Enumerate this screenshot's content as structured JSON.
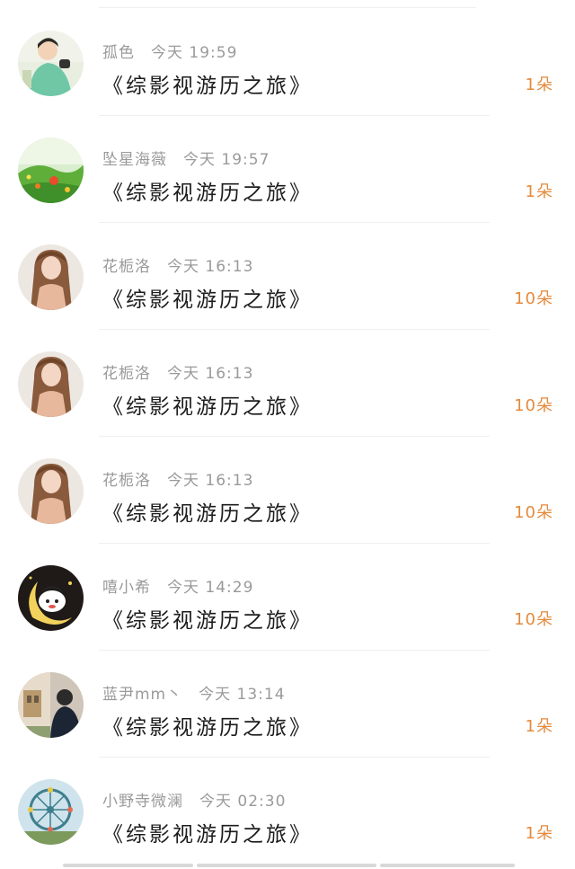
{
  "gifts": [
    {
      "user": "孤色",
      "time": "今天 19:59",
      "title": "《综影视游历之旅》",
      "amount": "1朵",
      "avatar": "boy-green-shirt"
    },
    {
      "user": "坠星海薇",
      "time": "今天 19:57",
      "title": "《综影视游历之旅》",
      "amount": "1朵",
      "avatar": "flowers-garden"
    },
    {
      "user": "花栀洛",
      "time": "今天 16:13",
      "title": "《综影视游历之旅》",
      "amount": "10朵",
      "avatar": "girl-long-hair"
    },
    {
      "user": "花栀洛",
      "time": "今天 16:13",
      "title": "《综影视游历之旅》",
      "amount": "10朵",
      "avatar": "girl-long-hair"
    },
    {
      "user": "花栀洛",
      "time": "今天 16:13",
      "title": "《综影视游历之旅》",
      "amount": "10朵",
      "avatar": "girl-long-hair"
    },
    {
      "user": "嘻小希",
      "time": "今天 14:29",
      "title": "《综影视游历之旅》",
      "amount": "10朵",
      "avatar": "cartoon-boy-moon"
    },
    {
      "user": "蓝尹mm丶",
      "time": "今天 13:14",
      "title": "《综影视游历之旅》",
      "amount": "1朵",
      "avatar": "man-street"
    },
    {
      "user": "小野寺微澜",
      "time": "今天 02:30",
      "title": "《综影视游历之旅》",
      "amount": "1朵",
      "avatar": "ferris-wheel"
    }
  ],
  "colors": {
    "amount": "#e58a3c",
    "meta": "#9a9a9a",
    "title": "#1c1c1c"
  }
}
